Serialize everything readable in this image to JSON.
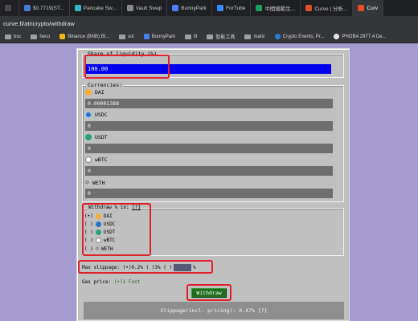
{
  "browser": {
    "tabs": [
      {
        "label": "",
        "color": "#4a4a4a"
      },
      {
        "label": "$0.7719(ST...",
        "color": "#4b7bd6"
      },
      {
        "label": "Pancake Sw...",
        "color": "#31b8c7"
      },
      {
        "label": "Vault Swap",
        "color": "#888888"
      },
      {
        "label": "BunnyPark",
        "color": "#4d7ef6"
      },
      {
        "label": "ForTube",
        "color": "#2f8cff"
      },
      {
        "label": "中間模範生...",
        "color": "#1fa05c"
      },
      {
        "label": "Curve | 分析...",
        "color": "#e0502b"
      },
      {
        "label": "Curv",
        "color": "#e0502b"
      }
    ],
    "url": "curve.fi/atricrypto/withdraw",
    "bookmarks": [
      {
        "label": "bsc",
        "icon": "folder-icon"
      },
      {
        "label": "heco",
        "icon": "folder-icon"
      },
      {
        "label": "Binance (BNB) Bl...",
        "icon": "binance-icon"
      },
      {
        "label": "sol",
        "icon": "folder-icon"
      },
      {
        "label": "BunnyPark",
        "icon": "bunnypark-icon"
      },
      {
        "label": "lit",
        "icon": "folder-icon"
      },
      {
        "label": "智能工具",
        "icon": "folder-icon"
      },
      {
        "label": "matic",
        "icon": "folder-icon"
      },
      {
        "label": "Crypto Events, Pr...",
        "icon": "crypto-events-icon"
      },
      {
        "label": "PHOBA 2977.4 De...",
        "icon": "phoba-icon"
      }
    ]
  },
  "share": {
    "legend": "Share of liquidity (%)",
    "value": "100.00"
  },
  "currencies": {
    "legend": "Currencies:",
    "items": [
      {
        "name": "DAI",
        "value": "0.00001388",
        "icon": "dai-icon",
        "color": "#f5ac37"
      },
      {
        "name": "USDC",
        "value": "0",
        "icon": "usdc-icon",
        "color": "#2775ca"
      },
      {
        "name": "USDT",
        "value": "0",
        "icon": "usdt-icon",
        "color": "#26a17b"
      },
      {
        "name": "wBTC",
        "value": "0",
        "icon": "wbtc-icon",
        "color": "#ffffff"
      },
      {
        "name": "WETH",
        "value": "0",
        "icon": "weth-icon",
        "color": "#333333"
      }
    ]
  },
  "withdraw_in": {
    "legend": "Withdraw % in:",
    "help": "[?]",
    "options": [
      {
        "radio": "(•)",
        "name": "DAI",
        "icon": "dai-icon",
        "color": "#f5ac37"
      },
      {
        "radio": "( )",
        "name": "USDC",
        "icon": "usdc-icon",
        "color": "#2775ca"
      },
      {
        "radio": "( )",
        "name": "USDT",
        "icon": "usdt-icon",
        "color": "#26a17b"
      },
      {
        "radio": "( )",
        "name": "wBTC",
        "icon": "wbtc-icon",
        "color": "#ffffff"
      },
      {
        "radio": "( )",
        "name": "WETH",
        "icon": "weth-icon",
        "color": "#333333"
      }
    ]
  },
  "max_slippage": {
    "label": "Max slippage:",
    "opt1": "(•)0.2%",
    "opt2": "( )3%",
    "opt3": "( )",
    "unit": "%"
  },
  "gas_price": {
    "label": "Gas price:",
    "option": "(•)1 Fast"
  },
  "withdraw_button": "Withdraw",
  "slippage_info": "Slippage(incl. pricing): 0.47% [?]",
  "colors": {
    "page_bg": "#a69bd1",
    "panel_bg": "#c0c0c0",
    "highlight": "#e0202a",
    "share_input_bg": "#0000ee",
    "button_bg": "#1f6f1f"
  }
}
